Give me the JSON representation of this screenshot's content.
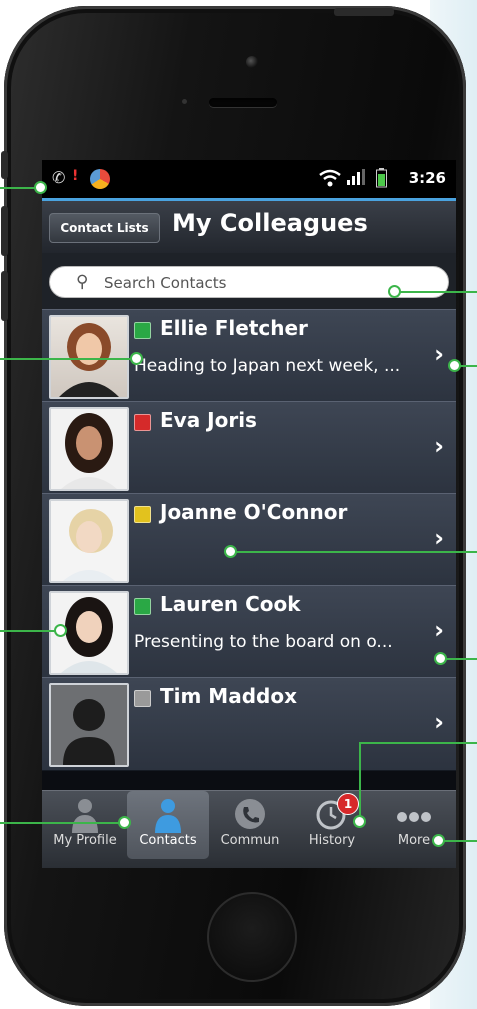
{
  "status_bar": {
    "time": "3:26"
  },
  "header": {
    "contact_lists_label": "Contact Lists",
    "title": "My Colleagues"
  },
  "search": {
    "placeholder": "Search Contacts"
  },
  "contacts": [
    {
      "name": "Ellie Fletcher",
      "status_color": "#2aa845",
      "message": "Heading to Japan next week, ..."
    },
    {
      "name": "Eva Joris",
      "status_color": "#d52a2a",
      "message": ""
    },
    {
      "name": "Joanne O'Connor",
      "status_color": "#e2c21e",
      "message": ""
    },
    {
      "name": "Lauren Cook",
      "status_color": "#2aa845",
      "message": "Presenting to the board on o..."
    },
    {
      "name": "Tim Maddox",
      "status_color": "#9a9a9a",
      "message": ""
    }
  ],
  "tabs": [
    {
      "label": "My Profile",
      "icon": "person-icon"
    },
    {
      "label": "Contacts",
      "icon": "person-icon"
    },
    {
      "label": "Commun",
      "icon": "phone-icon"
    },
    {
      "label": "History",
      "icon": "clock-icon",
      "badge": "1"
    },
    {
      "label": "More",
      "icon": "dots-icon"
    }
  ],
  "colors": {
    "accent": "#3cb54a",
    "status_bar_line": "#4aa3df"
  }
}
